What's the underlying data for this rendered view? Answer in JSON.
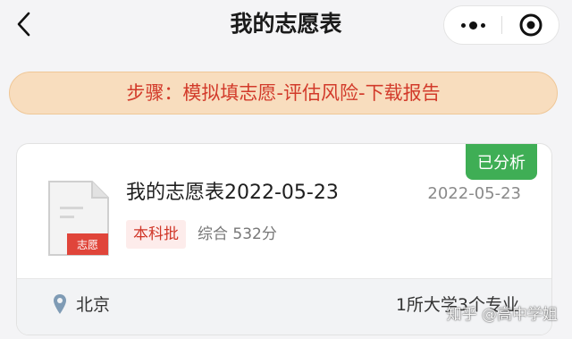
{
  "header": {
    "title": "我的志愿表",
    "back_icon": "chevron-left-icon",
    "more_icon": "more-dots-icon",
    "close_icon": "target-close-icon"
  },
  "banner": {
    "steps_text": "步骤：模拟填志愿-评估风险-下载报告",
    "accent_color": "#d23a2a",
    "background_color": "#f8ddbe"
  },
  "card": {
    "status_badge": "已分析",
    "status_color": "#3fae55",
    "doc_icon_label": "志愿",
    "plan_title": "我的志愿表2022-05-23",
    "date": "2022-05-23",
    "batch_tag": "本科批",
    "score_text": "综合 532分",
    "location": "北京",
    "summary": "1所大学3个专业"
  },
  "watermark": "知乎 @高中学姐"
}
